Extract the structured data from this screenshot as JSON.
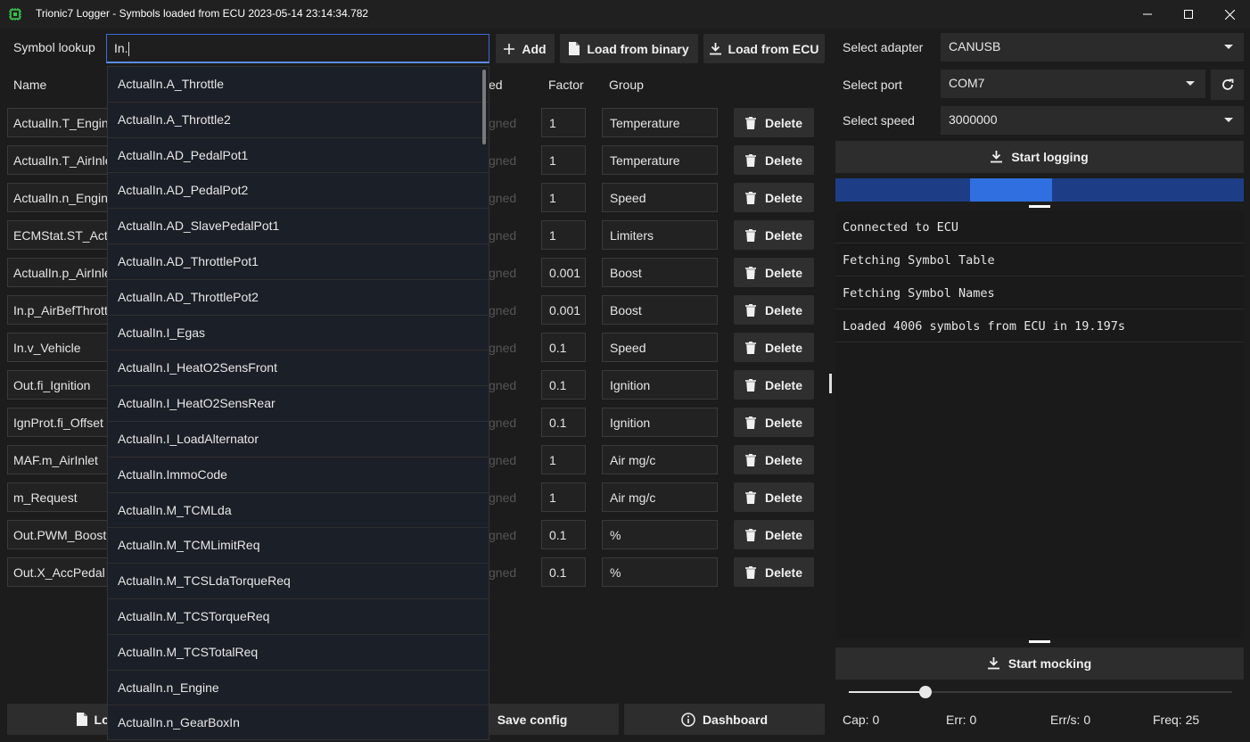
{
  "window": {
    "title": "Trionic7 Logger - Symbols loaded from ECU 2023-05-14 23:14:34.782"
  },
  "toolbar": {
    "lookup_label": "Symbol lookup",
    "lookup_value": "In.",
    "add_label": "Add",
    "load_binary_label": "Load from binary",
    "load_ecu_label": "Load from ECU"
  },
  "headers": {
    "name": "Name",
    "signed": "ed",
    "factor": "Factor",
    "group": "Group"
  },
  "rows": [
    {
      "name": "ActualIn.T_Engine",
      "signed": "gned",
      "factor": "1",
      "group": "Temperature",
      "delete": "Delete"
    },
    {
      "name": "ActualIn.T_AirInlet",
      "signed": "gned",
      "factor": "1",
      "group": "Temperature",
      "delete": "Delete"
    },
    {
      "name": "ActualIn.n_Engine",
      "signed": "gned",
      "factor": "1",
      "group": "Speed",
      "delete": "Delete"
    },
    {
      "name": "ECMStat.ST_Active",
      "signed": "gned",
      "factor": "1",
      "group": "Limiters",
      "delete": "Delete"
    },
    {
      "name": "ActualIn.p_AirInlet",
      "signed": "gned",
      "factor": "0.001",
      "group": "Boost",
      "delete": "Delete"
    },
    {
      "name": "In.p_AirBefThrottle",
      "signed": "gned",
      "factor": "0.001",
      "group": "Boost",
      "delete": "Delete"
    },
    {
      "name": "In.v_Vehicle",
      "signed": "gned",
      "factor": "0.1",
      "group": "Speed",
      "delete": "Delete"
    },
    {
      "name": "Out.fi_Ignition",
      "signed": "gned",
      "factor": "0.1",
      "group": "Ignition",
      "delete": "Delete"
    },
    {
      "name": "IgnProt.fi_Offset",
      "signed": "gned",
      "factor": "0.1",
      "group": "Ignition",
      "delete": "Delete"
    },
    {
      "name": "MAF.m_AirInlet",
      "signed": "gned",
      "factor": "1",
      "group": "Air mg/c",
      "delete": "Delete"
    },
    {
      "name": "m_Request",
      "signed": "gned",
      "factor": "1",
      "group": "Air mg/c",
      "delete": "Delete"
    },
    {
      "name": "Out.PWM_BoostCntrl",
      "signed": "gned",
      "factor": "0.1",
      "group": "%",
      "delete": "Delete"
    },
    {
      "name": "Out.X_AccPedal",
      "signed": "gned",
      "factor": "0.1",
      "group": "%",
      "delete": "Delete"
    }
  ],
  "dropdown": {
    "items": [
      "ActualIn.A_Throttle",
      "ActualIn.A_Throttle2",
      "ActualIn.AD_PedalPot1",
      "ActualIn.AD_PedalPot2",
      "ActualIn.AD_SlavePedalPot1",
      "ActualIn.AD_ThrottlePot1",
      "ActualIn.AD_ThrottlePot2",
      "ActualIn.I_Egas",
      "ActualIn.I_HeatO2SensFront",
      "ActualIn.I_HeatO2SensRear",
      "ActualIn.I_LoadAlternator",
      "ActualIn.ImmoCode",
      "ActualIn.M_TCMLda",
      "ActualIn.M_TCMLimitReq",
      "ActualIn.M_TCSLdaTorqueReq",
      "ActualIn.M_TCSTorqueReq",
      "ActualIn.M_TCSTotalReq",
      "ActualIn.n_Engine",
      "ActualIn.n_GearBoxIn"
    ]
  },
  "bottom": {
    "load_label": "Loa",
    "save_label": "Save config",
    "dashboard_label": "Dashboard"
  },
  "settings": {
    "adapter_label": "Select adapter",
    "adapter_value": "CANUSB",
    "port_label": "Select port",
    "port_value": "COM7",
    "speed_label": "Select speed",
    "speed_value": "3000000",
    "start_logging_label": "Start logging",
    "start_mocking_label": "Start mocking"
  },
  "log": {
    "lines": [
      "Connected to ECU",
      "Fetching Symbol Table",
      "Fetching Symbol Names",
      "Loaded 4006 symbols from ECU in 19.197s"
    ]
  },
  "progress": {
    "segment_start_fraction": 0.33,
    "segment_end_fraction": 0.53
  },
  "slider": {
    "value_fraction": 0.2
  },
  "stats": {
    "cap": "Cap: 0",
    "err": "Err: 0",
    "errs": "Err/s: 0",
    "freq": "Freq: 25"
  },
  "colors": {
    "accent": "#2f6fe0",
    "progress_track": "#1d3e86",
    "background": "#1c1c1c",
    "button": "#2d2d2d"
  }
}
